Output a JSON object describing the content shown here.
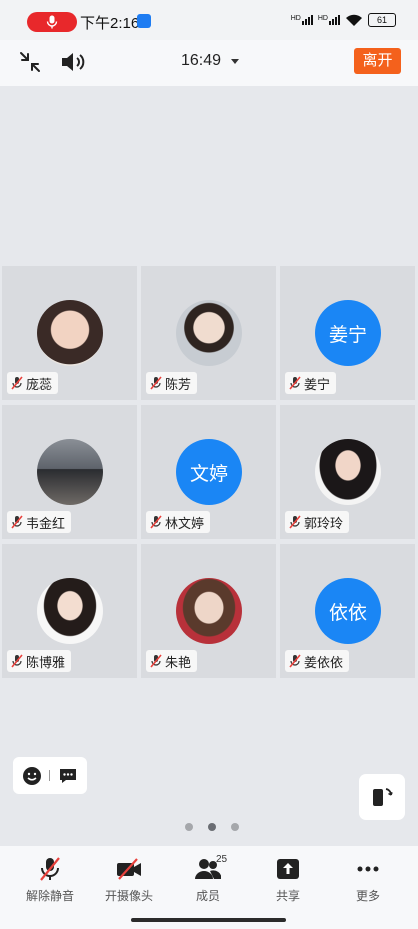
{
  "status_bar": {
    "time": "下午2:16",
    "network_1": "HD",
    "network_2": "HD",
    "battery": "61"
  },
  "top_bar": {
    "meeting_time": "16:49",
    "leave_label": "离开"
  },
  "participants": [
    {
      "name": "庞蕊",
      "avatar_text": "",
      "muted": true
    },
    {
      "name": "陈芳",
      "avatar_text": "",
      "muted": true
    },
    {
      "name": "姜宁",
      "avatar_text": "姜宁",
      "muted": true
    },
    {
      "name": "韦金红",
      "avatar_text": "",
      "muted": true
    },
    {
      "name": "林文婷",
      "avatar_text": "文婷",
      "muted": true
    },
    {
      "name": "郭玲玲",
      "avatar_text": "",
      "muted": true
    },
    {
      "name": "陈博雅",
      "avatar_text": "",
      "muted": true
    },
    {
      "name": "朱艳",
      "avatar_text": "",
      "muted": true
    },
    {
      "name": "姜依依",
      "avatar_text": "依依",
      "muted": true
    }
  ],
  "pagination": {
    "pages": 3,
    "current": 2
  },
  "bottom_bar": {
    "unmute_label": "解除静音",
    "camera_label": "开摄像头",
    "members_label": "成员",
    "members_count": "25",
    "share_label": "共享",
    "more_label": "更多"
  },
  "colors": {
    "accent_blue": "#1a86f5",
    "leave_orange": "#f4611c",
    "mute_red": "#e8413c",
    "recording_red": "#e8282b"
  },
  "icons": [
    "microphone-icon",
    "minimize-icon",
    "speaker-icon",
    "muted-mic-icon",
    "emoji-icon",
    "chat-icon",
    "rotate-screen-icon",
    "camera-off-icon",
    "members-icon",
    "share-icon",
    "more-icon"
  ]
}
